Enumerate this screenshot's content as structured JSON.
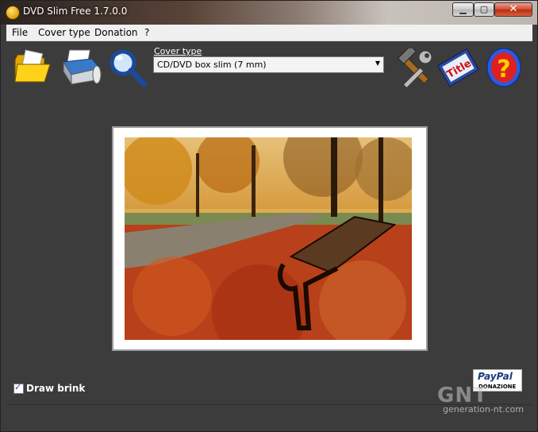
{
  "window": {
    "title": "DVD Slim Free 1.7.0.0"
  },
  "menu": {
    "items": [
      "File",
      "Cover type",
      "Donation",
      "?"
    ]
  },
  "toolbar": {
    "icons": [
      "open-folder-icon",
      "print-icon",
      "preview-magnifier-icon",
      "settings-tools-icon",
      "title-edit-icon",
      "help-icon"
    ],
    "cover_type_label": "Cover type",
    "cover_type_value": "CD/DVD box slim (7 mm)"
  },
  "options": {
    "draw_brink_label": "Draw brink",
    "draw_brink_checked": true
  },
  "donation": {
    "brand": "PayPal",
    "sub": "DONAZIONE"
  },
  "watermark": {
    "logo": "GNT",
    "site": "generation-nt.com"
  },
  "colors": {
    "background": "#3c3c3c",
    "accent": "#2a9ad8"
  }
}
